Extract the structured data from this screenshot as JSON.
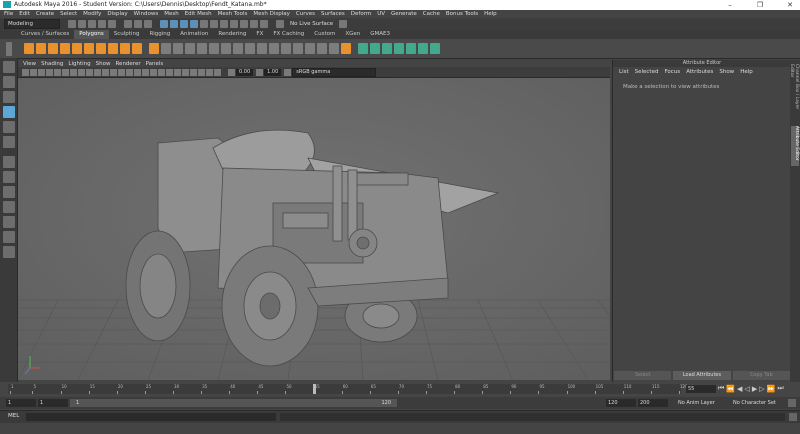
{
  "window": {
    "title": "Autodesk Maya 2016 - Student Version: C:\\Users\\Dennis\\Desktop\\Fendt_Katana.mb*",
    "minimize": "–",
    "maximize": "❐",
    "close": "✕"
  },
  "menubar": [
    "File",
    "Edit",
    "Create",
    "Select",
    "Modify",
    "Display",
    "Windows",
    "Mesh",
    "Edit Mesh",
    "Mesh Tools",
    "Mesh Display",
    "Curves",
    "Surfaces",
    "Deform",
    "UV",
    "Generate",
    "Cache",
    "Bonus Tools",
    "Help"
  ],
  "statusline": {
    "mode": "Modeling",
    "live_surface": "No Live Surface"
  },
  "shelf_tabs": [
    "Curves / Surfaces",
    "Polygons",
    "Sculpting",
    "Rigging",
    "Animation",
    "Rendering",
    "FX",
    "FX Caching",
    "Custom",
    "XGen",
    "GMAE3"
  ],
  "shelf_active_tab": "Polygons",
  "panel_menu": [
    "View",
    "Shading",
    "Lighting",
    "Show",
    "Renderer",
    "Panels"
  ],
  "panel_toolbar": {
    "exposure": "0.00",
    "gamma": "1.00",
    "colorspace": "sRGB gamma"
  },
  "attribute_editor": {
    "title": "Attribute Editor",
    "menu": [
      "List",
      "Selected",
      "Focus",
      "Attributes",
      "Show",
      "Help"
    ],
    "message": "Make a selection to view attributes",
    "buttons": [
      {
        "label": "Select",
        "enabled": false
      },
      {
        "label": "Load Attributes",
        "enabled": true
      },
      {
        "label": "Copy Tab",
        "enabled": false
      }
    ]
  },
  "side_tabs": [
    "Channel Box / Layer Editor",
    "Attribute Editor"
  ],
  "timeline": {
    "ticks": [
      "1",
      "5",
      "10",
      "15",
      "20",
      "25",
      "30",
      "35",
      "40",
      "45",
      "50",
      "55",
      "60",
      "65",
      "70",
      "75",
      "80",
      "85",
      "90",
      "95",
      "100",
      "105",
      "110",
      "115",
      "120"
    ],
    "current_frame": "55",
    "current_frame_value": 55
  },
  "range": {
    "start": "1",
    "playback_start": "1",
    "slider_start": "1",
    "slider_end": "120",
    "playback_end": "120",
    "end": "200",
    "anim_layer": "No Anim Layer",
    "char_set": "No Character Set"
  },
  "cmdline": {
    "label": "MEL"
  },
  "colors": {
    "viewport_bg": "#6b6b6b",
    "accent_orange": "#e8912d",
    "accent_teal": "#43a98d",
    "active_tool": "#5da6d6"
  }
}
